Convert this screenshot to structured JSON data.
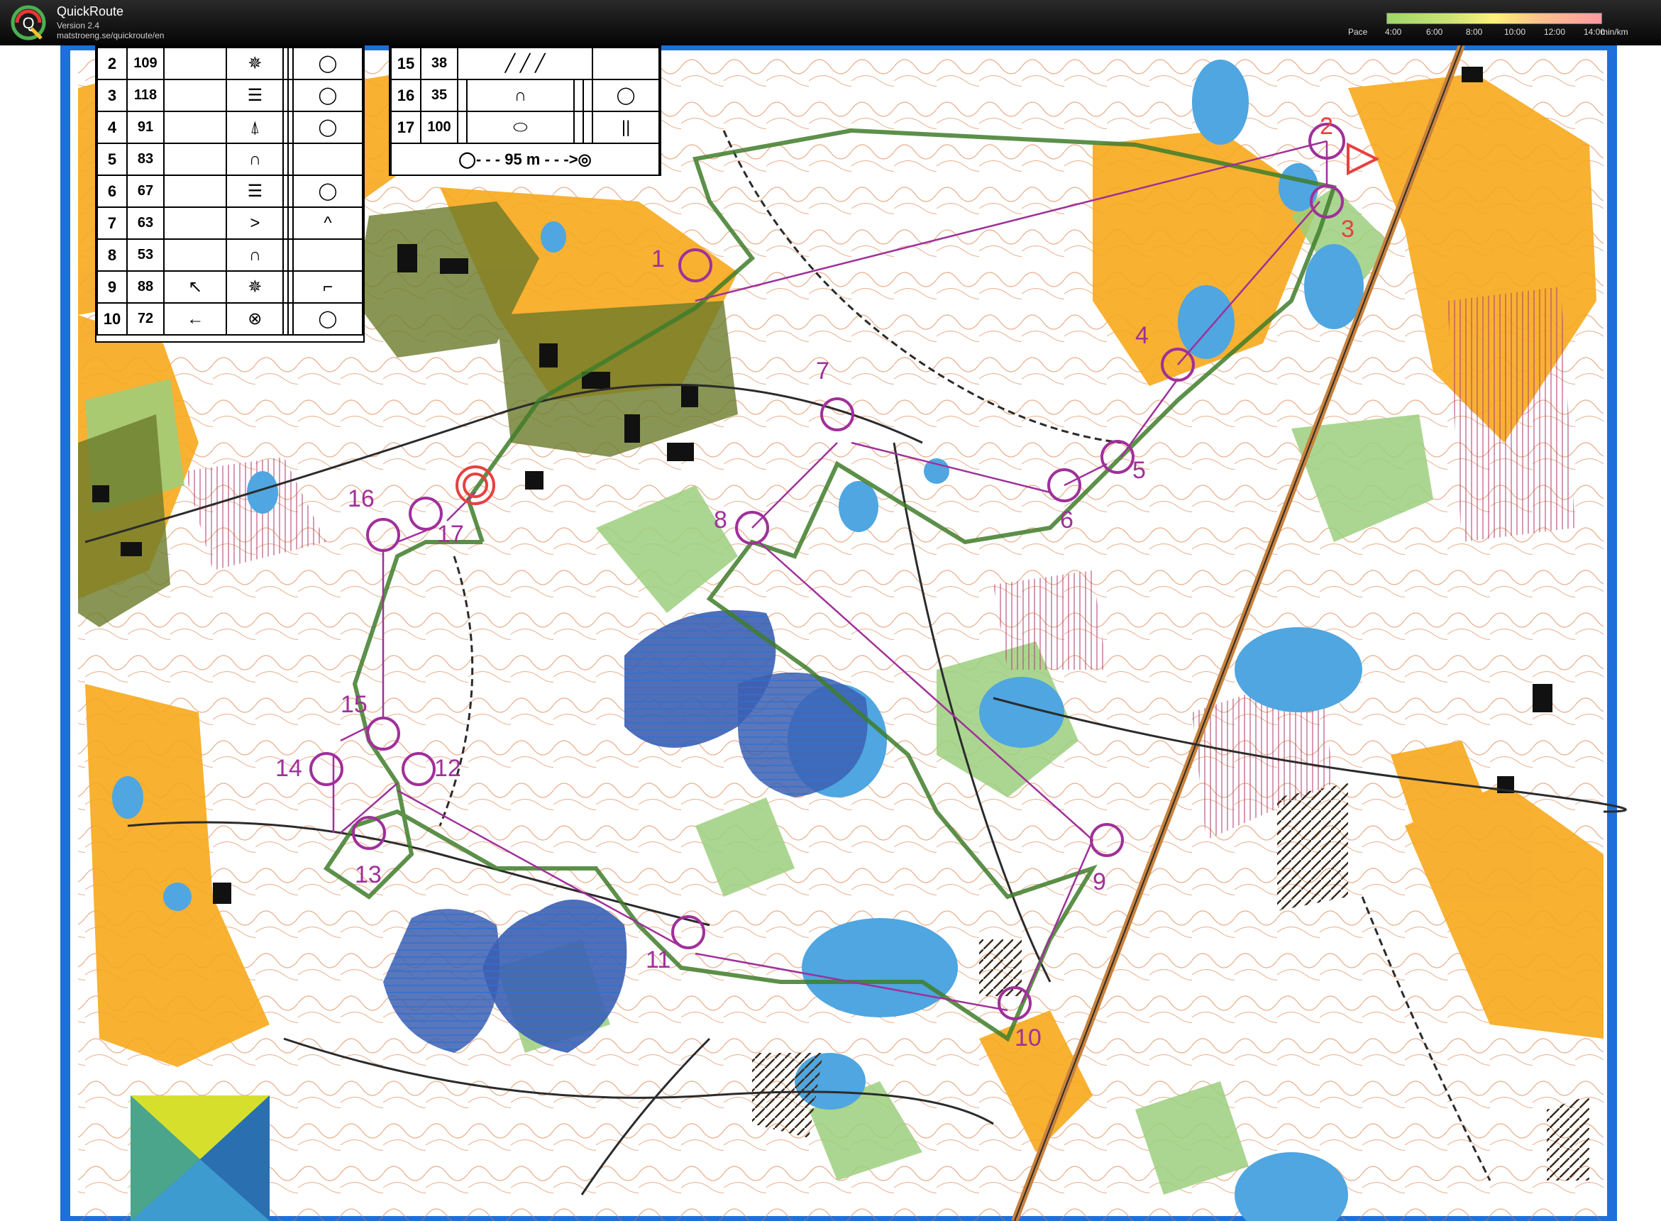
{
  "app": {
    "title": "QuickRoute",
    "version": "Version 2.4",
    "url": "matstroeng.se/quickroute/en"
  },
  "pace_legend": {
    "label": "Pace",
    "ticks": [
      "4:00",
      "6:00",
      "8:00",
      "10:00",
      "12:00",
      "14:00"
    ],
    "unit": "min/km",
    "colors": [
      "#9ed66a",
      "#cde377",
      "#fff07a",
      "#ffc38a",
      "#ff9aa3"
    ]
  },
  "control_descriptions": {
    "left": [
      {
        "num": "2",
        "code": "109",
        "feature": "✵",
        "position": "◯"
      },
      {
        "num": "3",
        "code": "118",
        "feature": "☰",
        "position": "◯"
      },
      {
        "num": "4",
        "code": "91",
        "feature": "⍋",
        "position": "◯"
      },
      {
        "num": "5",
        "code": "83",
        "feature": "∩",
        "position": ""
      },
      {
        "num": "6",
        "code": "67",
        "feature": "☰",
        "position": "◯"
      },
      {
        "num": "7",
        "code": "63",
        "feature": ">",
        "position": "^"
      },
      {
        "num": "8",
        "code": "53",
        "feature": "∩",
        "position": ""
      },
      {
        "num": "9",
        "code": "88",
        "feature": "✵",
        "direction": "↖",
        "position": "⌐"
      },
      {
        "num": "10",
        "code": "72",
        "feature": "⊗",
        "direction": "←",
        "position": "◯"
      }
    ],
    "right": [
      {
        "num": "15",
        "code": "38",
        "feature": "╱ ╱ ╱",
        "position": ""
      },
      {
        "num": "16",
        "code": "35",
        "feature": "∩",
        "position": "◯"
      },
      {
        "num": "17",
        "code": "100",
        "feature": "⬭",
        "position": "||"
      }
    ],
    "finish": "95 m"
  },
  "controls": [
    {
      "label": "1"
    },
    {
      "label": "2"
    },
    {
      "label": "3"
    },
    {
      "label": "4"
    },
    {
      "label": "5"
    },
    {
      "label": "6"
    },
    {
      "label": "7"
    },
    {
      "label": "8"
    },
    {
      "label": "9"
    },
    {
      "label": "10"
    },
    {
      "label": "11"
    },
    {
      "label": "12"
    },
    {
      "label": "13"
    },
    {
      "label": "14"
    },
    {
      "label": "15"
    },
    {
      "label": "16"
    },
    {
      "label": "17"
    }
  ],
  "colors": {
    "course": "#a0309a",
    "route": "#3f7d2a",
    "open_land": "#f7a81b",
    "forest_green": "#9ccf7e",
    "water": "#4fa6e0",
    "contour": "#d8763a",
    "road": "#2b2b2b"
  }
}
